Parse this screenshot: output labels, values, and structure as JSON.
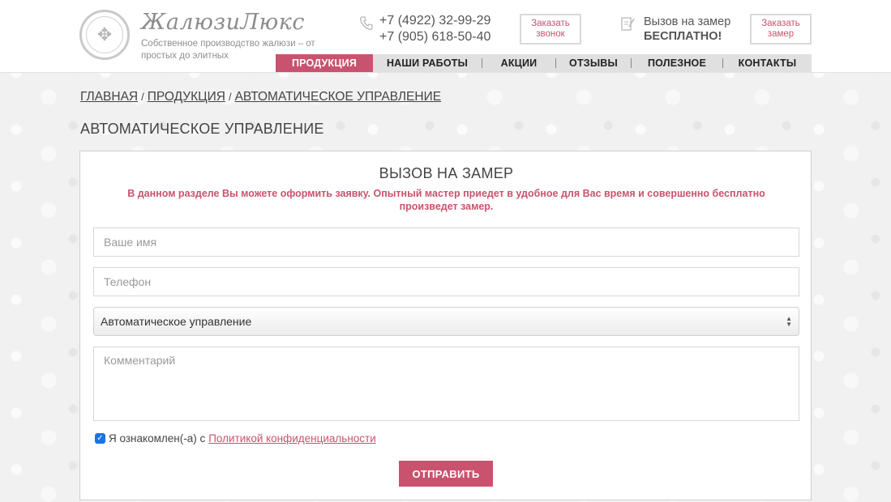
{
  "header": {
    "brand": "ЖалюзиЛюкс",
    "slogan": "Собственное производство жалюзи – от простых до элитных",
    "phones": [
      "+7 (4922) 32-99-29",
      "+7 (905) 618-50-40"
    ],
    "callback_button": [
      "Заказать",
      "звонок"
    ],
    "measure_line1": "Вызов на замер",
    "measure_line2": "БЕСПЛАТНО!",
    "measure_button": [
      "Заказать",
      "замер"
    ],
    "phone_icon": "phone-icon",
    "clipboard_icon": "clipboard-icon"
  },
  "nav": {
    "items": [
      {
        "label": "ПРОДУКЦИЯ",
        "active": true
      },
      {
        "label": "НАШИ РАБОТЫ",
        "active": false
      },
      {
        "label": "АКЦИИ",
        "active": false
      },
      {
        "label": "ОТЗЫВЫ",
        "active": false
      },
      {
        "label": "ПОЛЕЗНОЕ",
        "active": false
      },
      {
        "label": "КОНТАКТЫ",
        "active": false
      }
    ]
  },
  "breadcrumb": {
    "items": [
      "ГЛАВНАЯ",
      "ПРОДУКЦИЯ",
      "АВТОМАТИЧЕСКОЕ УПРАВЛЕНИЕ"
    ],
    "separator": "/"
  },
  "page_title": "АВТОМАТИЧЕСКОЕ УПРАВЛЕНИЕ",
  "form": {
    "title": "ВЫЗОВ НА ЗАМЕР",
    "description": "В данном разделе Вы можете оформить заявку. Опытный мастер приедет в удобное для Вас время и совершенно бесплатно произведет замер.",
    "name_placeholder": "Ваше имя",
    "phone_placeholder": "Телефон",
    "select_value": "Автоматическое управление",
    "comment_placeholder": "Комментарий",
    "agree_text": "Я ознакомлен(-а) с",
    "agree_link": "Политикой конфиденциальности",
    "agree_checked": true,
    "submit_label": "ОТПРАВИТЬ"
  },
  "colors": {
    "accent": "#c9536e",
    "nav_bg": "#e0e0e0",
    "checkbox": "#1a73e8"
  }
}
